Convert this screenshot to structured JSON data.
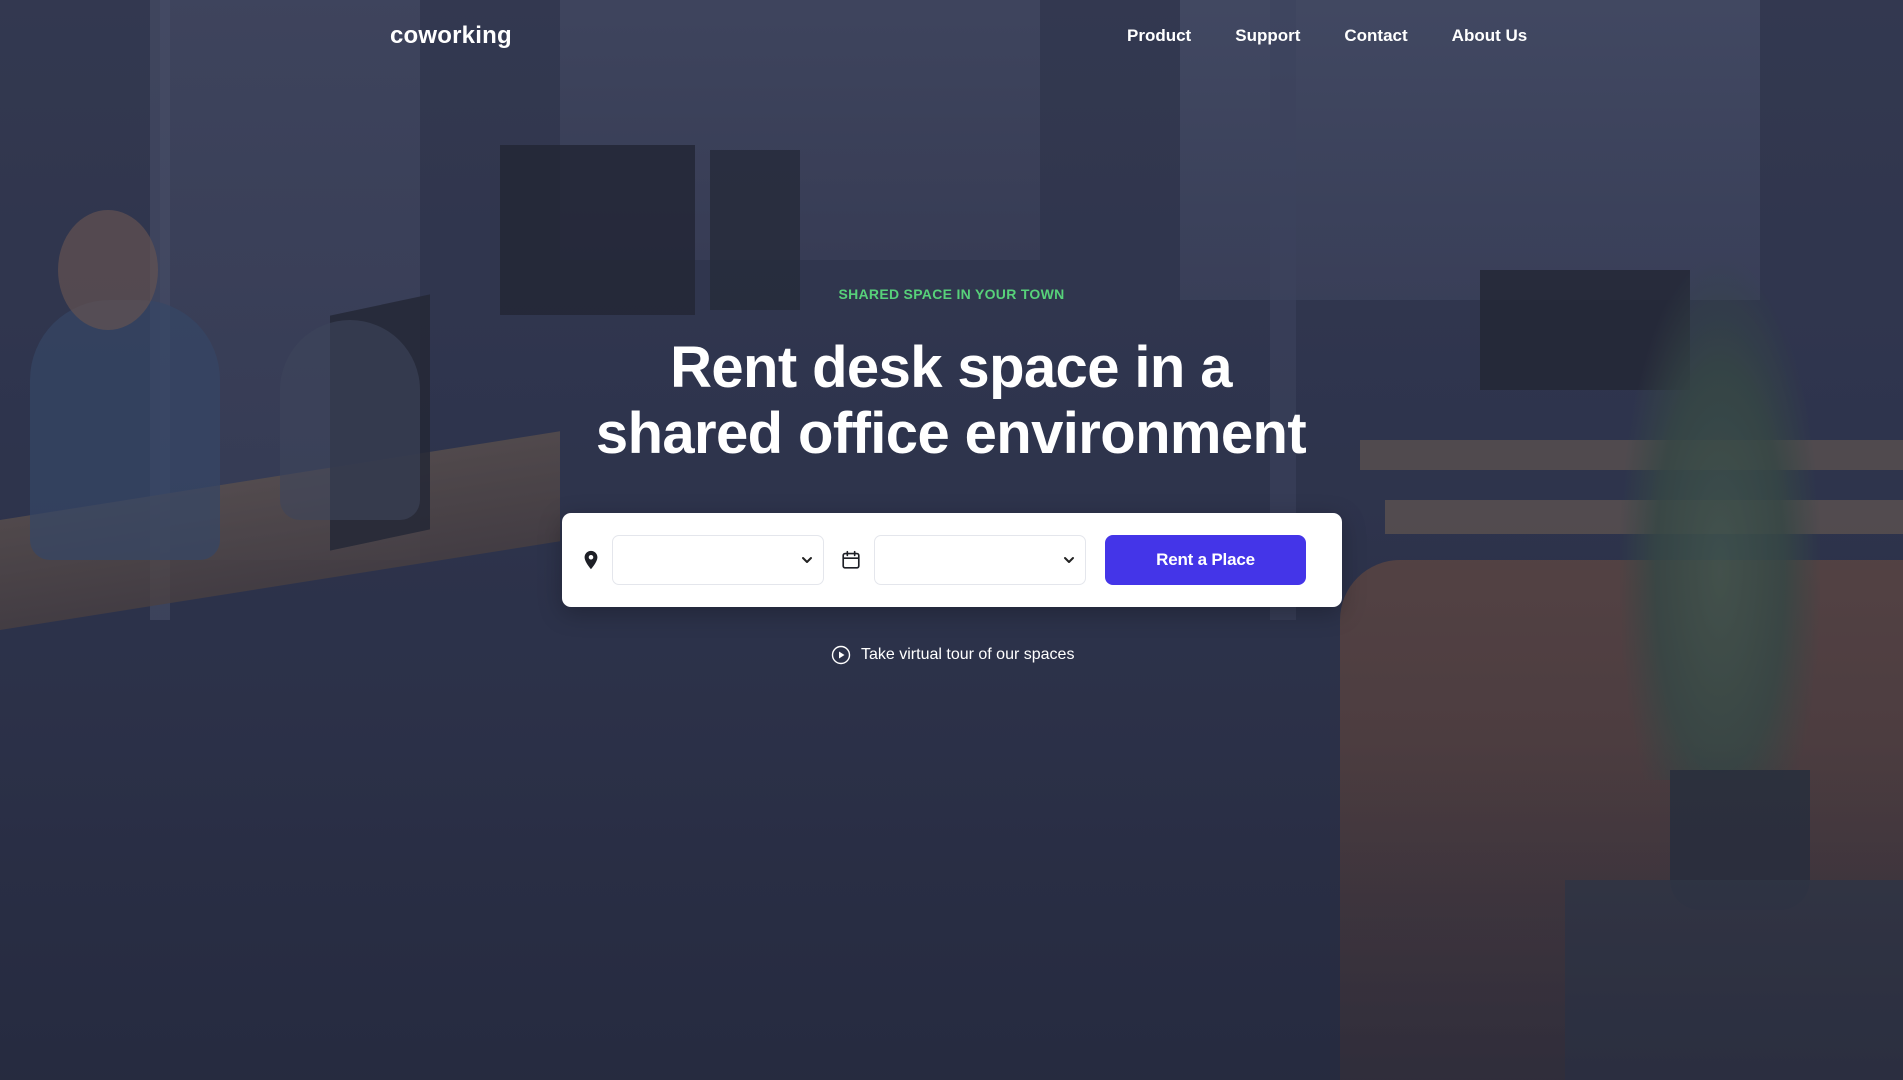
{
  "brand": {
    "logo": "coworking"
  },
  "nav": {
    "links": [
      {
        "label": "Product"
      },
      {
        "label": "Support"
      },
      {
        "label": "Contact"
      },
      {
        "label": "About Us"
      }
    ]
  },
  "hero": {
    "eyebrow": "SHARED SPACE IN YOUR TOWN",
    "headline_line1": "Rent desk space in a",
    "headline_line2": "shared office environment",
    "eyebrow_color": "#57d17a"
  },
  "search": {
    "location_icon": "map-pin-icon",
    "location_value": "",
    "date_icon": "calendar-icon",
    "date_value": "",
    "submit_label": "Rent a Place",
    "submit_color": "#4435e8"
  },
  "tour": {
    "icon": "play-circle-icon",
    "label": "Take virtual tour of our spaces"
  }
}
